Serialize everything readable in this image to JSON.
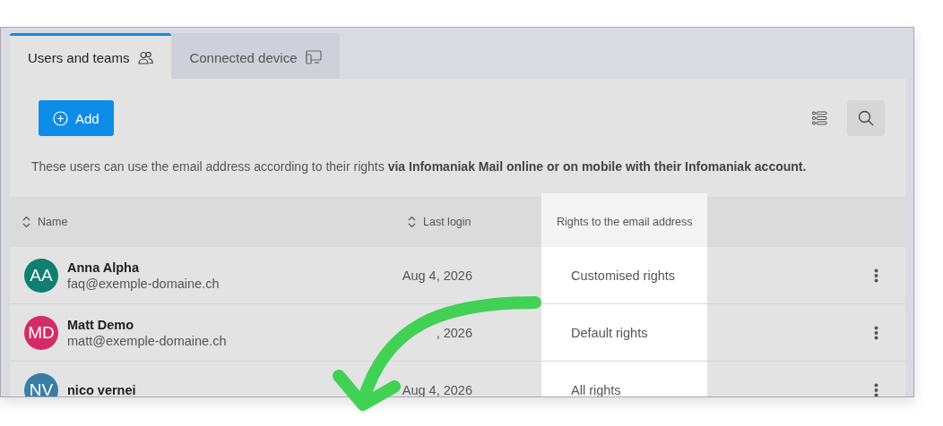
{
  "tabs": [
    {
      "label": "Users and teams",
      "selected": true
    },
    {
      "label": "Connected device",
      "selected": false
    }
  ],
  "toolbar": {
    "add_button": "Add"
  },
  "description": "These users can use the email address according to their rights **via Infomaniak Mail online or on mobile with their Infomaniak account.**",
  "table": {
    "columns": [
      {
        "label": "Name",
        "sortable": true,
        "highlighted": false
      },
      {
        "label": "Last login",
        "sortable": true,
        "highlighted": false
      },
      {
        "label": "Rights to the email address",
        "sortable": false,
        "highlighted": true
      }
    ],
    "rows": [
      {
        "initials": "AA",
        "color": "#0f7f6f",
        "name": "Anna Alpha",
        "email": "faq@exemple-domaine.ch",
        "last_login": "Aug 4, 2026",
        "rights": "Customised rights"
      },
      {
        "initials": "MD",
        "color": "#d42a66",
        "name": "Matt Demo",
        "email": "matt@exemple-domaine.ch",
        "last_login": ", 2026",
        "rights": "Default rights"
      },
      {
        "initials": "NV",
        "color": "#3a7ea6",
        "name": "nico vernei",
        "last_login": "Aug 4, 2026",
        "rights": "All rights"
      }
    ]
  }
}
